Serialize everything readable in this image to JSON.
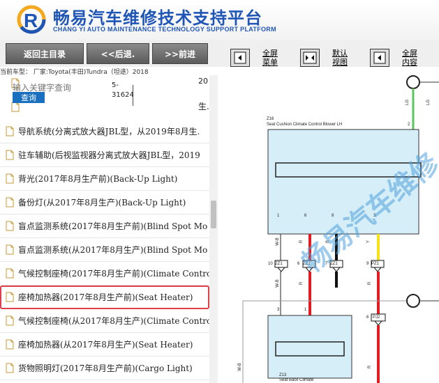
{
  "header": {
    "title_cn": "畅易汽车维修技术支持平台",
    "title_en": "CHANG YI AUTO MAINTENANCE TECHNOLOGY SUPPORT PLATFORM"
  },
  "toolbar": {
    "back_main": "返回主目录",
    "prev": "<<后退.",
    "next": ">>前进",
    "fullscreen_menu": [
      "全屏",
      "菜单"
    ],
    "default_view": [
      "默认",
      "视图"
    ],
    "fullscreen_content": [
      "全屏",
      "内容"
    ]
  },
  "breadcrumb": "当前车型： 厂家:Toyota(丰田)Tundra（坦途）2018",
  "search": {
    "placeholder": "输入关键字查询",
    "button": "查询"
  },
  "partno": [
    "5-",
    "31624"
  ],
  "top_right_20": "20",
  "top_right_sheng": "生.",
  "list": [
    {
      "label": "导航系统(分离式放大器JBL型，从2019年8月生.",
      "selected": false
    },
    {
      "label": "驻车辅助(后视监视器分离式放大器JBL型，2019",
      "selected": false
    },
    {
      "label": "背光(2017年8月生产前)(Back-Up Light)",
      "selected": false
    },
    {
      "label": "备份灯(从2017年8月生产)(Back-Up Light)",
      "selected": false
    },
    {
      "label": "盲点监测系统(2017年8月生产前)(Blind Spot Mo",
      "selected": false
    },
    {
      "label": "盲点监测系统(从2017年8月生产)(Blind Spot Mo",
      "selected": false
    },
    {
      "label": "气候控制座椅(2017年8月生产前)(Climate Contro",
      "selected": false
    },
    {
      "label": "座椅加热器(2017年8月生产前)(Seat Heater)",
      "selected": true
    },
    {
      "label": "气候控制座椅(从2017年8月生产)(Climate Contro",
      "selected": false
    },
    {
      "label": "座椅加热器(从2017年8月生产)(Seat Heater)",
      "selected": false
    },
    {
      "label": "货物照明灯(2017年8月生产前)(Cargo Light)",
      "selected": false
    }
  ],
  "diagram": {
    "z16": "Z16",
    "z16_name": "Seat Cushion Climate Control Blower LH",
    "z13": "Z13",
    "z13_name": "Seat Back Climate",
    "wire_lg1": "LG",
    "wire_lg2": "LG",
    "pin_2": "2",
    "pins_top": [
      "1",
      "6",
      "8",
      "3"
    ],
    "wires_top": [
      "W-B",
      "R",
      "B",
      "Y"
    ],
    "connectors": [
      "ZZ1",
      "ZZ1",
      "ZZ1",
      "PZ1"
    ],
    "conn_nums": [
      "10",
      "6",
      "7",
      "9"
    ],
    "wires_mid": [
      "W-B",
      "R",
      "R"
    ],
    "pj2": "PJ2",
    "pj2_num": "6",
    "pins_bottom": [
      "3",
      "1"
    ],
    "wire_wb_bottom": "W-B",
    "wire_r_bottom": "R",
    "watermark": "畅易汽车维修"
  },
  "colors": {
    "brand_blue": "#1f56b6",
    "selected_outline": "#e0404d",
    "diagram_box": "#d6eef7",
    "wire_red": "#e31b23",
    "wire_black": "#111111",
    "wire_yellow": "#f4e21a",
    "wire_green": "#5cc45c"
  }
}
